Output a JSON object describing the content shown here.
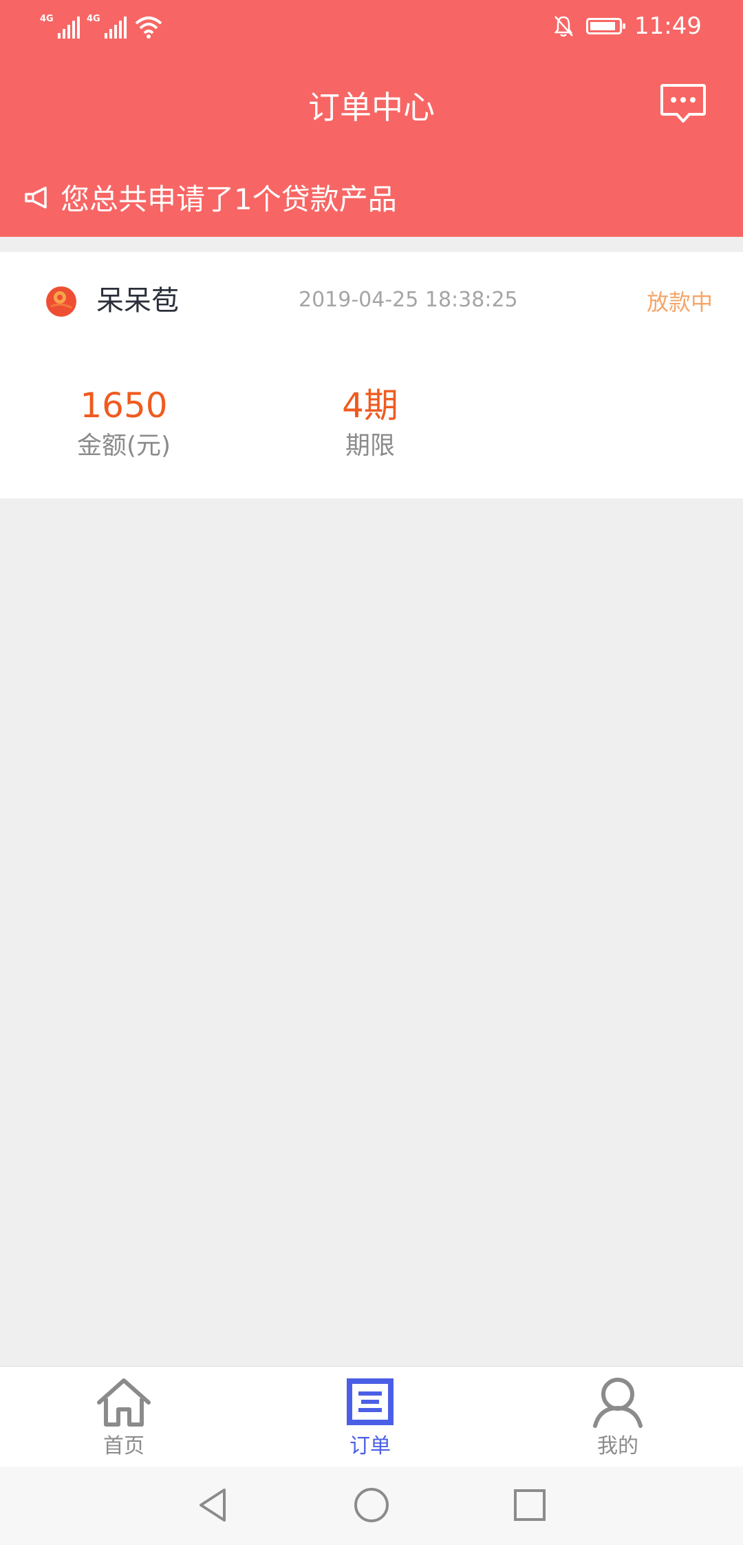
{
  "status_bar": {
    "time": "11:49",
    "network1": "4G",
    "network2": "4G",
    "icons": [
      "signal-icon",
      "signal-icon",
      "wifi-icon",
      "bell-off-icon",
      "battery-icon"
    ],
    "battery_level": 0.9
  },
  "header": {
    "title": "订单中心",
    "message_icon": "message-icon",
    "notice_icon": "megaphone-icon",
    "notice_text": "您总共申请了1个贷款产品",
    "background": "#f76664"
  },
  "order": {
    "product_name": "呆呆苞",
    "product_logo_icon": "product-logo-icon",
    "time": "2019-04-25 18:38:25",
    "status": "放款中",
    "amount_value": "1650",
    "amount_label": "金额(元)",
    "term_value": "4期",
    "term_label": "期限",
    "accent_color": "#ef5b1f",
    "status_color": "#f5a56a"
  },
  "tabs": [
    {
      "label": "首页",
      "icon": "home-icon",
      "active": false
    },
    {
      "label": "订单",
      "icon": "order-icon",
      "active": true
    },
    {
      "label": "我的",
      "icon": "user-icon",
      "active": false
    }
  ],
  "tab_active_color": "#4b5fe6",
  "nav": {
    "back_icon": "back-triangle-icon",
    "home_icon": "home-circle-icon",
    "recent_icon": "recent-square-icon"
  }
}
